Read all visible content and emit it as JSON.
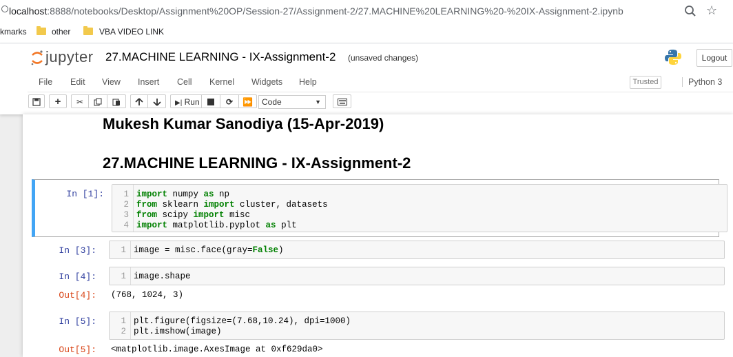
{
  "browser": {
    "url_host": "localhost",
    "url_path": ":8888/notebooks/Desktop/Assignment%20OP/Session-27/Assignment-2/27.MACHINE%20LEARNING%20-%20IX-Assignment-2.ipynb",
    "bookmarks": [
      "kmarks",
      "other",
      "VBA VIDEO LINK"
    ]
  },
  "jupyter": {
    "logo_text": "jupyter",
    "notebook_title": "27.MACHINE LEARNING - IX-Assignment-2",
    "save_status": "(unsaved changes)",
    "logout_label": "Logout",
    "menu": [
      "File",
      "Edit",
      "View",
      "Insert",
      "Cell",
      "Kernel",
      "Widgets",
      "Help"
    ],
    "trusted_label": "Trusted",
    "kernel_name": "Python 3",
    "run_label": "Run",
    "cell_type": "Code"
  },
  "notebook": {
    "heading_author": "Mukesh Kumar Sanodiya (15-Apr-2019)",
    "heading_title": "27.MACHINE LEARNING - IX-Assignment-2",
    "cells": [
      {
        "prompt": "In [1]:",
        "lines": [
          {
            "n": "1",
            "kw1": "import",
            "a": " numpy ",
            "kw2": "as",
            "b": " np"
          },
          {
            "n": "2",
            "kw1": "from",
            "a": " sklearn ",
            "kw2": "import",
            "b": " cluster, datasets"
          },
          {
            "n": "3",
            "kw1": "from",
            "a": " scipy ",
            "kw2": "import",
            "b": " misc"
          },
          {
            "n": "4",
            "kw1": "import",
            "a": " matplotlib.pyplot ",
            "kw2": "as",
            "b": " plt"
          }
        ]
      },
      {
        "prompt": "In [3]:",
        "lines": [
          {
            "n": "1",
            "a": "image = misc.face(gray=",
            "kw": "False",
            "b": ")"
          }
        ]
      },
      {
        "prompt": "In [4]:",
        "lines": [
          {
            "n": "1",
            "a": "image.shape"
          }
        ],
        "out_prompt": "Out[4]:",
        "output": "(768, 1024, 3)"
      },
      {
        "prompt": "In [5]:",
        "lines": [
          {
            "n": "1",
            "a": "plt.figure(figsize=(7.68,10.24), dpi=1000)"
          },
          {
            "n": "2",
            "a": "plt.imshow(image)"
          }
        ],
        "out_prompt": "Out[5]:",
        "output": "<matplotlib.image.AxesImage at 0xf629da0>"
      }
    ]
  }
}
